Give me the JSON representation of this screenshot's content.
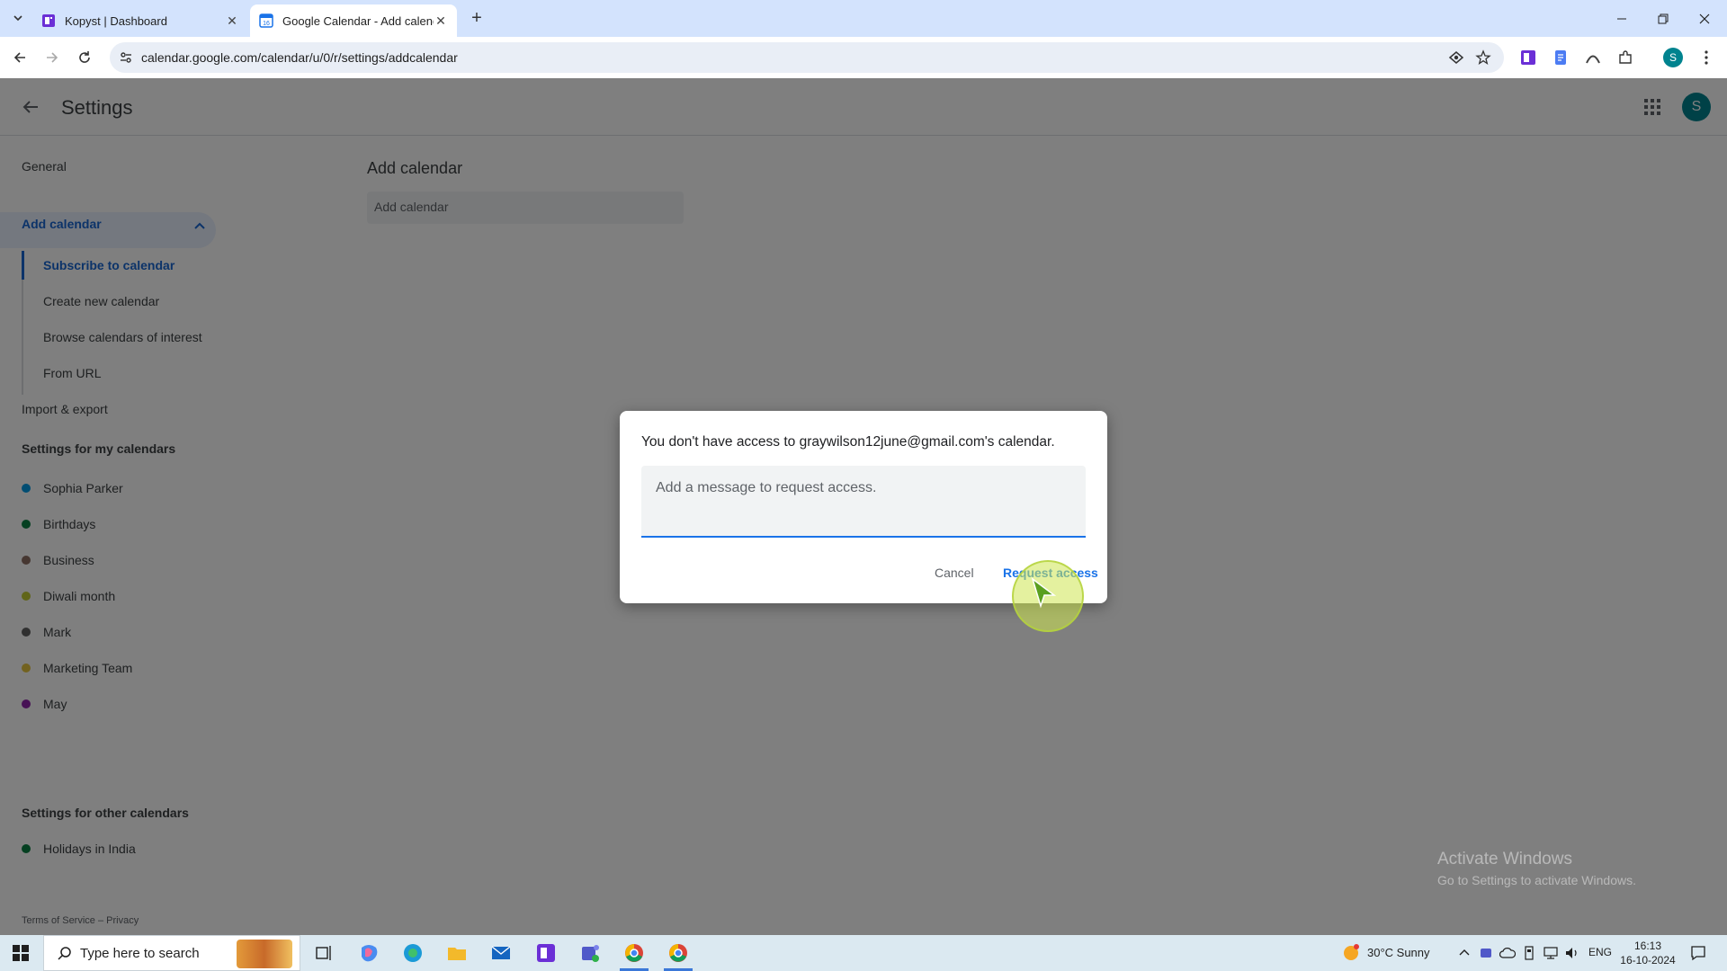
{
  "browser": {
    "tabs": [
      {
        "title": "Kopyst | Dashboard",
        "active": false
      },
      {
        "title": "Google Calendar - Add calendar",
        "active": true
      }
    ],
    "url": "calendar.google.com/calendar/u/0/r/settings/addcalendar"
  },
  "header": {
    "title": "Settings",
    "avatar_letter": "S"
  },
  "sidebar": {
    "general": "General",
    "add_calendar": "Add calendar",
    "sub_items": [
      "Subscribe to calendar",
      "Create new calendar",
      "Browse calendars of interest",
      "From URL"
    ],
    "import_export": "Import & export",
    "my_calendars_heading": "Settings for my calendars",
    "my_calendars": [
      {
        "name": "Sophia Parker",
        "color": "#039be5"
      },
      {
        "name": "Birthdays",
        "color": "#0b8043"
      },
      {
        "name": "Business",
        "color": "#8d6e63"
      },
      {
        "name": "Diwali month",
        "color": "#c0ca33"
      },
      {
        "name": "Mark",
        "color": "#616161"
      },
      {
        "name": "Marketing Team",
        "color": "#e4c441"
      },
      {
        "name": "May",
        "color": "#8e24aa"
      }
    ],
    "other_calendars_heading": "Settings for other calendars",
    "other_calendars": [
      {
        "name": "Holidays in India",
        "color": "#0b8043"
      }
    ],
    "footer": "Terms of Service – Privacy"
  },
  "main": {
    "title": "Add calendar",
    "input_placeholder": "Add calendar"
  },
  "dialog": {
    "message": "You don't have access to graywilson12june@gmail.com's calendar.",
    "placeholder": "Add a message to request access.",
    "cancel": "Cancel",
    "request": "Request access"
  },
  "watermark": {
    "line1": "Activate Windows",
    "line2": "Go to Settings to activate Windows."
  },
  "taskbar": {
    "search_placeholder": "Type here to search",
    "weather": "30°C  Sunny",
    "language": "ENG",
    "time": "16:13",
    "date": "16-10-2024"
  },
  "colors": {
    "accent": "#1a73e8",
    "selected_bg": "#e8f0fe",
    "avatar": "#00838f"
  }
}
